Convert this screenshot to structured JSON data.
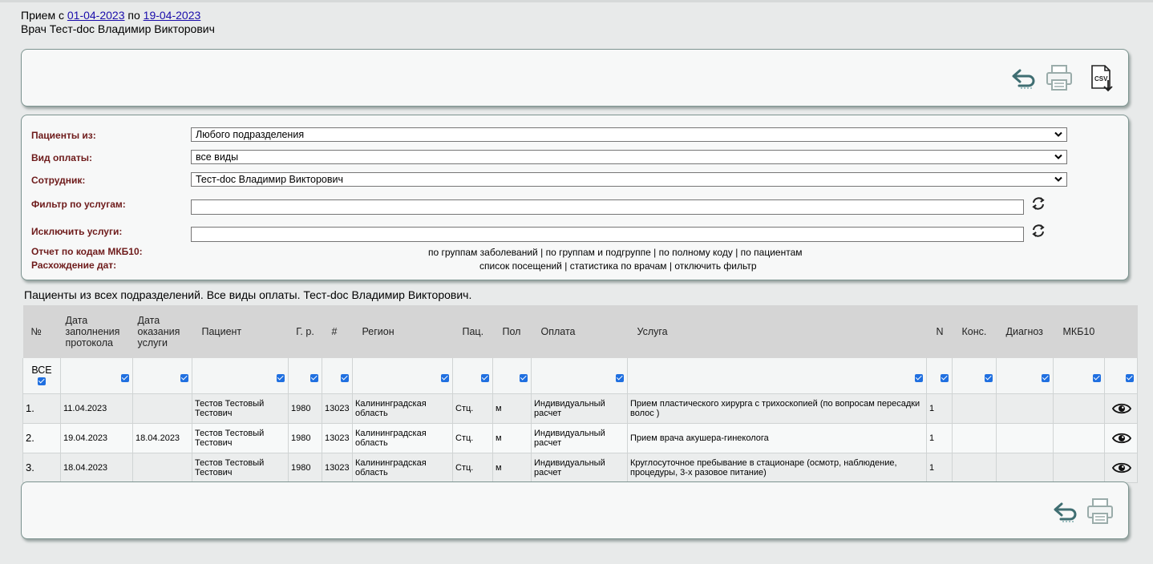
{
  "header": {
    "prefix": "Прием с",
    "date_from": "01-04-2023",
    "mid": "по",
    "date_to": "19-04-2023",
    "doctor_line": "Врач Тест-doc Владимир Викторович"
  },
  "toolbar": {
    "icons": [
      "back-arrow-icon",
      "printer-icon",
      "csv-export-icon"
    ]
  },
  "filters": {
    "patients_from_label": "Пациенты из:",
    "patients_from_value": "Любого подразделения",
    "payment_label": "Вид оплаты:",
    "payment_value": "все виды",
    "employee_label": "Сотрудник:",
    "employee_value": "Тест-doc Владимир Викторович",
    "service_filter_label": "Фильтр по услугам:",
    "service_filter_value": "",
    "exclude_label": "Исключить услуги:",
    "exclude_value": "",
    "mkb_label": "Отчет по кодам МКБ10:",
    "mkb_links": [
      "по группам заболеваний",
      "по группам и подгруппе",
      "по полному коду",
      "по пациентам"
    ],
    "dates_label": "Расхождение дат:",
    "dates_links": [
      "список посещений",
      "статистика по врачам",
      "отключить фильтр"
    ],
    "separator": "|"
  },
  "summary": "Пациенты из всех подразделений. Все виды оплаты. Тест-doc Владимир Викторович.",
  "table": {
    "columns": [
      "№",
      "Дата заполнения протокола",
      "Дата оказания услуги",
      "Пациент",
      "Г. р.",
      "#",
      "Регион",
      "Пац.",
      "Пол",
      "Оплата",
      "Услуга",
      "N",
      "Конс.",
      "Диагноз",
      "МКБ10",
      ""
    ],
    "all_label": "ВСЕ",
    "rows": [
      [
        "1.",
        "11.04.2023",
        "",
        "Тестов Тестовый Тестович",
        "1980",
        "13023",
        "Калининградская область",
        "Стц.",
        "м",
        "Индивидуальный расчет",
        "Прием пластического хирурга с трихоскопией (по вопросам пересадки волос )",
        "1",
        "",
        "",
        ""
      ],
      [
        "2.",
        "19.04.2023",
        "18.04.2023",
        "Тестов Тестовый Тестович",
        "1980",
        "13023",
        "Калининградская область",
        "Стц.",
        "м",
        "Индивидуальный расчет",
        "Прием врача акушера-гинеколога",
        "1",
        "",
        "",
        ""
      ],
      [
        "3.",
        "18.04.2023",
        "",
        "Тестов Тестовый Тестович",
        "1980",
        "13023",
        "Калининградская область",
        "Стц.",
        "м",
        "Индивидуальный расчет",
        "Круглосуточное пребывание в стационаре (осмотр, наблюдение, процедуры, 3-х разовое питание)",
        "1",
        "",
        "",
        ""
      ]
    ]
  },
  "colors": {
    "label_text": "#6e1b1b",
    "link": "#1a0dab",
    "checkbox": "#1f6fe0",
    "icon": "#3f6e72"
  }
}
